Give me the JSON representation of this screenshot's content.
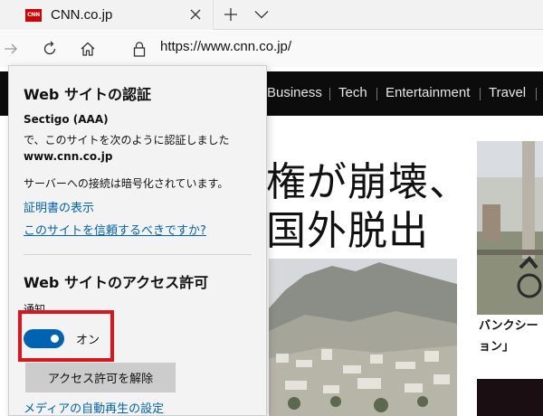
{
  "tab": {
    "favicon_text": "CNN",
    "title": "CNN.co.jp"
  },
  "address_bar": {
    "url": "https://www.cnn.co.jp/"
  },
  "page": {
    "nav_items": [
      "Business",
      "Tech",
      "Entertainment",
      "Travel"
    ],
    "headline_lines": [
      "権が崩壊、",
      "国外脱出"
    ],
    "side_caption_lines": [
      "バンクシー",
      "ョン」"
    ]
  },
  "flyout": {
    "verify_title": "Web サイトの認証",
    "issuer": "Sectigo (AAA)",
    "verify_text": "で、このサイトを次のように認証しました",
    "domain": "www.cnn.co.jp",
    "encrypted_text": "サーバーへの接続は暗号化されています。",
    "view_certificate": "証明書の表示",
    "trust_link": "このサイトを信頼するべきですか?",
    "permissions_title": "Web サイトのアクセス許可",
    "notifications_label": "通知",
    "toggle_state": "オン",
    "revoke_button": "アクセス許可を解除",
    "media_autoplay_link": "メディアの自動再生の設定"
  },
  "colors": {
    "accent_blue": "#0063b1",
    "highlight_red": "#d9161c",
    "cnn_red": "#cc0000",
    "cnn_nav_bg": "#0c0c0c"
  },
  "icons": [
    "close-icon",
    "plus-icon",
    "chevron-down-icon",
    "arrow-right-icon",
    "refresh-icon",
    "home-icon",
    "lock-icon"
  ]
}
